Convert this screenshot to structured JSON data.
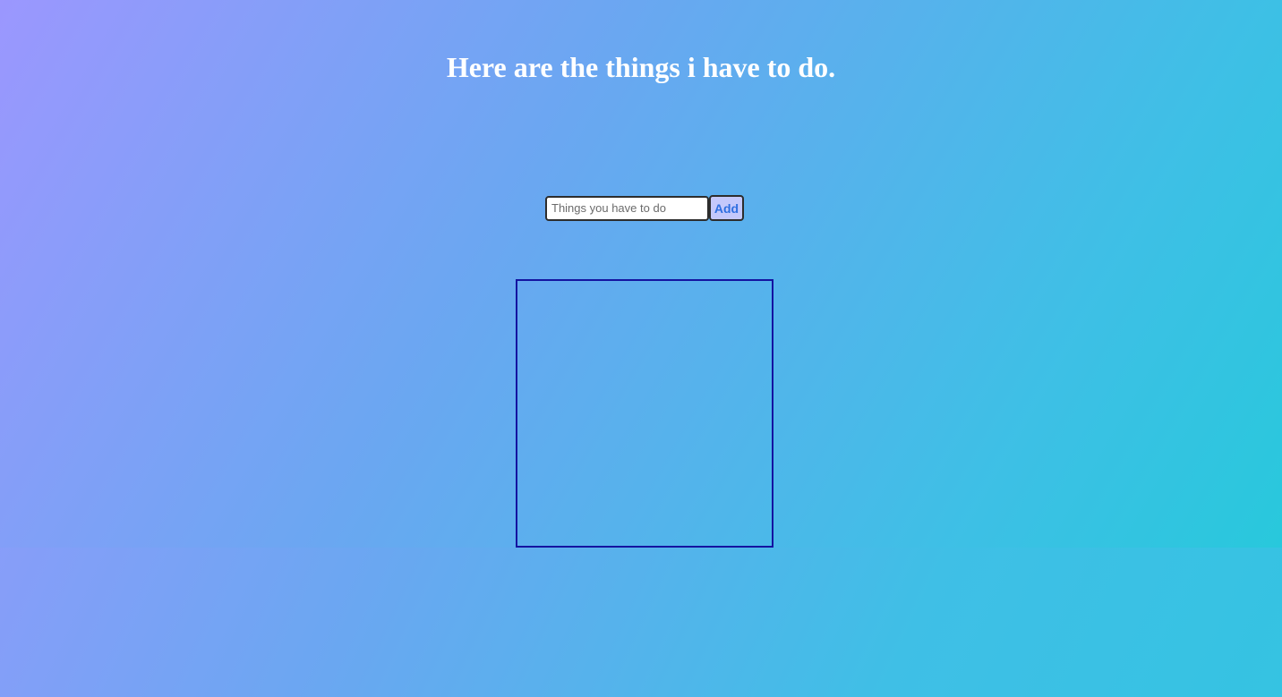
{
  "page": {
    "title": "Here are the things i have to do."
  },
  "form": {
    "input_placeholder": "Things you have to do",
    "input_value": "",
    "add_label": "Add"
  },
  "todo_list": {
    "items": []
  },
  "colors": {
    "gradient_start": "#9b97fe",
    "gradient_end": "#28c8dc",
    "list_border": "#1414a0",
    "add_button_bg": "#c4c8fb",
    "add_button_text": "#2f6fe0"
  }
}
